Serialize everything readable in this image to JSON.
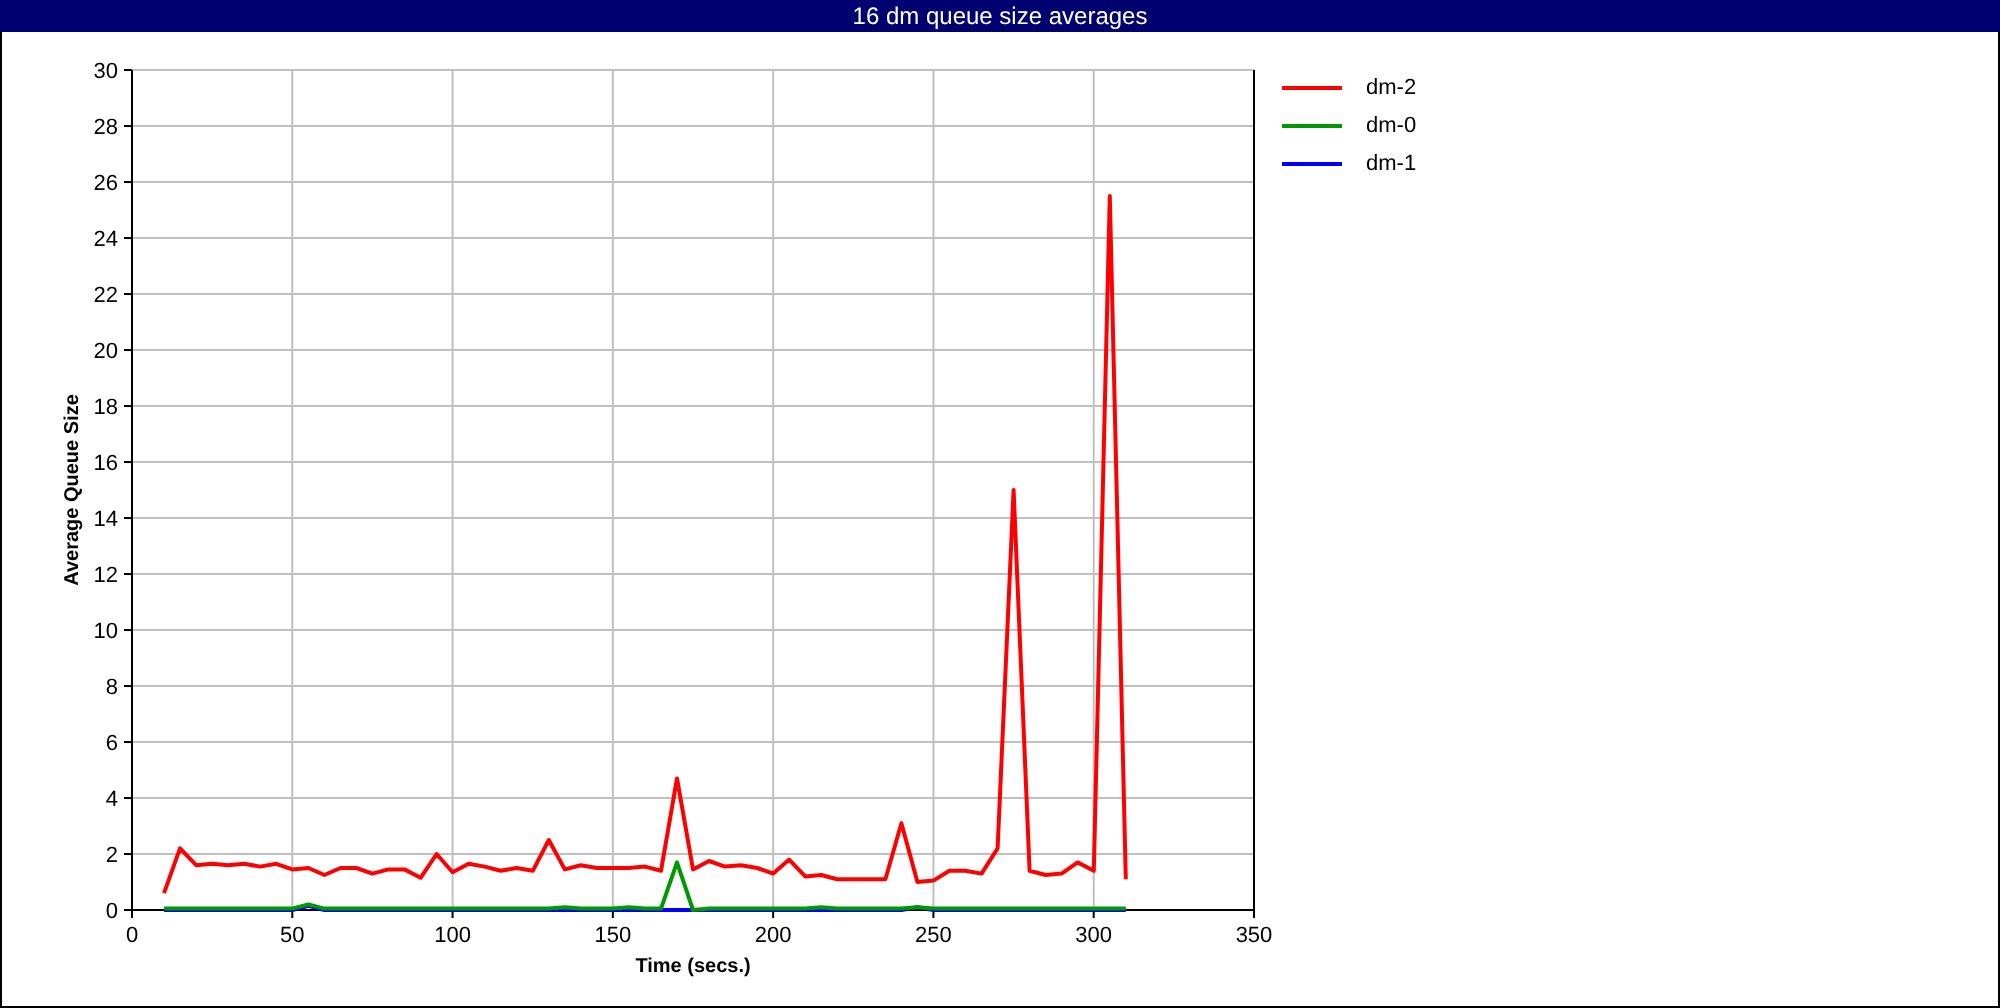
{
  "title": "16 dm queue size averages",
  "chart_data": {
    "type": "line",
    "grid": true,
    "xlabel": "Time (secs.)",
    "ylabel": "Average Queue Size",
    "xlim": [
      0,
      350
    ],
    "ylim": [
      0,
      30
    ],
    "xticks": [
      0,
      50,
      100,
      150,
      200,
      250,
      300,
      350
    ],
    "yticks": [
      0,
      2,
      4,
      6,
      8,
      10,
      12,
      14,
      16,
      18,
      20,
      22,
      24,
      26,
      28,
      30
    ],
    "x": [
      10,
      15,
      20,
      25,
      30,
      35,
      40,
      45,
      50,
      55,
      60,
      65,
      70,
      75,
      80,
      85,
      90,
      95,
      100,
      105,
      110,
      115,
      120,
      125,
      130,
      135,
      140,
      145,
      150,
      155,
      160,
      165,
      170,
      175,
      180,
      185,
      190,
      195,
      200,
      205,
      210,
      215,
      220,
      225,
      230,
      235,
      240,
      245,
      250,
      255,
      260,
      265,
      270,
      275,
      280,
      285,
      290,
      295,
      300,
      305,
      310
    ],
    "series": [
      {
        "name": "dm-2",
        "color": "#ff0000",
        "values": [
          0.6,
          2.2,
          1.6,
          1.65,
          1.6,
          1.65,
          1.55,
          1.65,
          1.45,
          1.5,
          1.25,
          1.5,
          1.5,
          1.3,
          1.45,
          1.45,
          1.15,
          2.0,
          1.35,
          1.65,
          1.55,
          1.4,
          1.5,
          1.4,
          2.5,
          1.45,
          1.6,
          1.5,
          1.5,
          1.5,
          1.55,
          1.4,
          4.7,
          1.45,
          1.75,
          1.55,
          1.6,
          1.5,
          1.3,
          1.8,
          1.2,
          1.25,
          1.1,
          1.1,
          1.1,
          1.1,
          3.1,
          1.0,
          1.05,
          1.4,
          1.4,
          1.3,
          2.2,
          15.0,
          1.4,
          1.25,
          1.3,
          1.7,
          1.4,
          25.5,
          1.1
        ]
      },
      {
        "name": "dm-0",
        "color": "#009900",
        "values": [
          0.05,
          0.05,
          0.05,
          0.05,
          0.05,
          0.05,
          0.05,
          0.05,
          0.05,
          0.2,
          0.05,
          0.05,
          0.05,
          0.05,
          0.05,
          0.05,
          0.05,
          0.05,
          0.05,
          0.05,
          0.05,
          0.05,
          0.05,
          0.05,
          0.05,
          0.1,
          0.05,
          0.05,
          0.05,
          0.1,
          0.05,
          0.05,
          1.7,
          0.0,
          0.05,
          0.05,
          0.05,
          0.05,
          0.05,
          0.05,
          0.05,
          0.1,
          0.05,
          0.05,
          0.05,
          0.05,
          0.05,
          0.1,
          0.05,
          0.05,
          0.05,
          0.05,
          0.05,
          0.05,
          0.05,
          0.05,
          0.05,
          0.05,
          0.05,
          0.05,
          0.05
        ]
      },
      {
        "name": "dm-1",
        "color": "#0000ff",
        "values": [
          0,
          0,
          0,
          0,
          0,
          0,
          0,
          0,
          0,
          0.15,
          0,
          0,
          0,
          0,
          0,
          0,
          0,
          0,
          0,
          0,
          0,
          0,
          0,
          0,
          0,
          0,
          0,
          0,
          0,
          0,
          0,
          0,
          0,
          0,
          0,
          0,
          0,
          0,
          0,
          0,
          0,
          0,
          0,
          0,
          0,
          0,
          0,
          0.1,
          0,
          0,
          0,
          0,
          0,
          0,
          0,
          0,
          0,
          0,
          0,
          0,
          0
        ]
      }
    ]
  }
}
